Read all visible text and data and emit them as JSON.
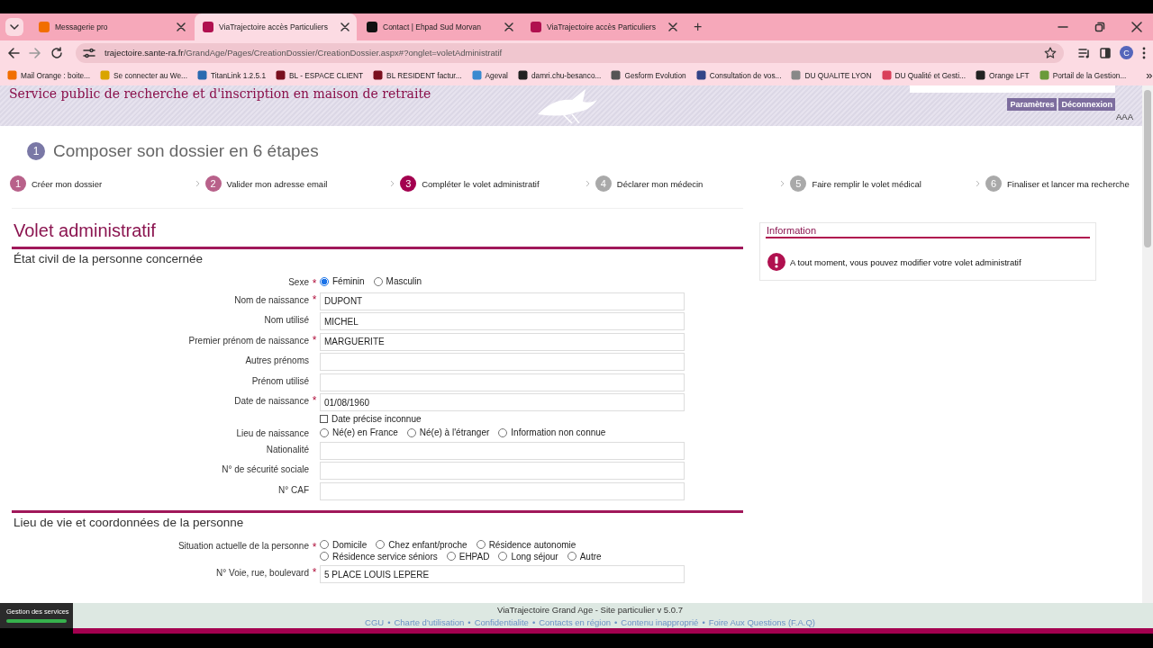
{
  "browser": {
    "tabs": [
      {
        "title": "Messagerie pro",
        "selected": false,
        "color": "#f16e00"
      },
      {
        "title": "ViaTrajectoire accès Particuliers",
        "selected": true,
        "color": "#b0104f"
      },
      {
        "title": "Contact | Ehpad Sud Morvan",
        "selected": false,
        "color": "#111111"
      },
      {
        "title": "ViaTrajectoire accès Particuliers",
        "selected": false,
        "color": "#b0104f"
      }
    ],
    "new_tab": "+",
    "address": {
      "host": "trajectoire.sante-ra.fr",
      "path": "/GrandAge/Pages/CreationDossier/CreationDossier.aspx#?onglet=voletAdministratif"
    },
    "profile": "C",
    "bookmarks": [
      "Mail Orange : boite...",
      "Se connecter au We...",
      "TitanLink 1.2.5.1",
      "BL - ESPACE CLIENT",
      "BL RESIDENT factur...",
      "Ageval",
      "damri.chu-besanco...",
      "Gesform Evolution",
      "Consultation de vos...",
      "DU QUALITE LYON",
      "DU Qualité et Gesti...",
      "Orange LFT",
      "Portail de la Gestion..."
    ],
    "bookmarks_more": "»"
  },
  "header": {
    "title": "Service public de recherche et d'inscription en maison de retraite",
    "buttons": [
      "Paramètres",
      "Déconnexion"
    ],
    "font_sizes": "AAA"
  },
  "steps_heading": {
    "number": "1",
    "title": "Composer son dossier en 6 étapes"
  },
  "steps": [
    {
      "number": "1",
      "label": "Créer mon dossier",
      "completed": true,
      "selected": false
    },
    {
      "number": "2",
      "label": "Valider mon adresse email",
      "completed": true,
      "selected": false
    },
    {
      "number": "3",
      "label": "Compléter le volet administratif",
      "completed": false,
      "selected": true
    },
    {
      "number": "4",
      "label": "Déclarer mon médecin",
      "completed": false,
      "selected": false
    },
    {
      "number": "5",
      "label": "Faire remplir le volet médical",
      "completed": false,
      "selected": false
    },
    {
      "number": "6",
      "label": "Finaliser et lancer ma recherche",
      "completed": false,
      "selected": false
    }
  ],
  "form": {
    "title": "Volet administratif",
    "required_mark": "*",
    "sections": [
      {
        "title": "État civil de la personne concernée",
        "fields": [
          {
            "kind": "radio",
            "label": "Sexe",
            "required": true,
            "option_rows": [
              [
                {
                  "label": "Féminin",
                  "selected": true
                },
                {
                  "label": "Masculin",
                  "selected": false
                }
              ]
            ]
          },
          {
            "kind": "text",
            "label": "Nom de naissance",
            "required": true,
            "value": "DUPONT"
          },
          {
            "kind": "text",
            "label": "Nom utilisé",
            "required": false,
            "value": "MICHEL"
          },
          {
            "kind": "text",
            "label": "Premier prénom de naissance",
            "required": true,
            "value": "MARGUERITE"
          },
          {
            "kind": "text",
            "label": "Autres prénoms",
            "required": false
          },
          {
            "kind": "text",
            "label": "Prénom utilisé",
            "required": false
          },
          {
            "kind": "text",
            "label": "Date de naissance",
            "required": true,
            "value": "01/08/1960"
          },
          {
            "kind": "checkbox",
            "label": "Date précise inconnue",
            "checked": false
          },
          {
            "kind": "radio",
            "label": "Lieu de naissance",
            "required": false,
            "option_rows": [
              [
                {
                  "label": "Né(e) en France",
                  "selected": false
                },
                {
                  "label": "Né(e) à l'étranger",
                  "selected": false
                },
                {
                  "label": "Information non connue",
                  "selected": false
                }
              ]
            ]
          },
          {
            "kind": "text",
            "label": "Nationalité",
            "required": false
          },
          {
            "kind": "text",
            "label": "N° de sécurité sociale",
            "required": false
          },
          {
            "kind": "text",
            "label": "N° CAF",
            "required": false
          }
        ]
      },
      {
        "title": "Lieu de vie et coordonnées de la personne",
        "fields": [
          {
            "kind": "radio",
            "label": "Situation actuelle de la personne",
            "required": true,
            "option_rows": [
              [
                {
                  "label": "Domicile",
                  "selected": false
                },
                {
                  "label": "Chez enfant/proche",
                  "selected": false
                },
                {
                  "label": "Résidence autonomie",
                  "selected": false
                }
              ],
              [
                {
                  "label": "Résidence service séniors",
                  "selected": false
                },
                {
                  "label": "EHPAD",
                  "selected": false
                },
                {
                  "label": "Long séjour",
                  "selected": false
                },
                {
                  "label": "Autre",
                  "selected": false
                }
              ]
            ]
          },
          {
            "kind": "text",
            "label": "N° Voie, rue, boulevard",
            "required": true,
            "value": "5 PLACE LOUIS LEPERE"
          }
        ]
      }
    ]
  },
  "info": {
    "title": "Information",
    "message": "A tout moment, vous pouvez modifier votre volet administratif"
  },
  "footer": {
    "version": "ViaTrajectoire Grand Age - Site particulier v 5.0.7",
    "separator": "•",
    "links": [
      "CGU",
      "Charte d'utilisation",
      "Confidentialite",
      "Contacts en région",
      "Contenu inapproprié",
      "Foire Aux Questions (F.A.Q)"
    ]
  },
  "services_badge": "Gestion des services"
}
